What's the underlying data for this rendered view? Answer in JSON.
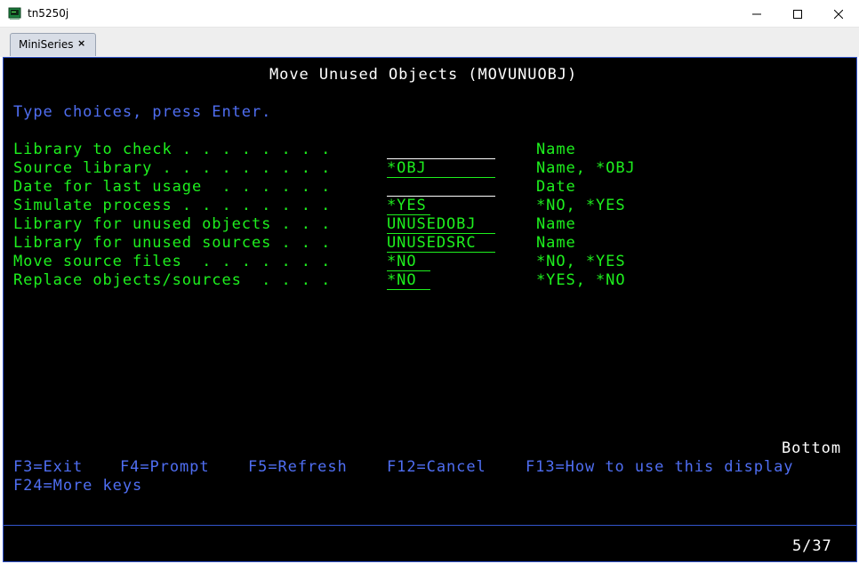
{
  "window": {
    "title": "tn5250j"
  },
  "tabs": [
    {
      "label": "MiniSeries",
      "close": "×"
    }
  ],
  "screen": {
    "title": "Move Unused Objects (MOVUNUOBJ)",
    "instruction": "Type choices, press Enter.",
    "rows": [
      {
        "label": "Library to check . . . . . . . .",
        "value": "",
        "hint": "Name"
      },
      {
        "label": "Source library . . . . . . . . .",
        "value": "*OBJ",
        "hint": "Name, *OBJ"
      },
      {
        "label": "Date for last usage  . . . . . .",
        "value": "",
        "hint": "Date"
      },
      {
        "label": "Simulate process . . . . . . . .",
        "value": "*YES",
        "hint": "*NO, *YES"
      },
      {
        "label": "Library for unused objects . . .",
        "value": "UNUSEDOBJ",
        "hint": "Name"
      },
      {
        "label": "Library for unused sources . . .",
        "value": "UNUSEDSRC",
        "hint": "Name"
      },
      {
        "label": "Move source files  . . . . . . .",
        "value": "*NO",
        "hint": "*NO, *YES"
      },
      {
        "label": "Replace objects/sources  . . . .",
        "value": "*NO",
        "hint": "*YES, *NO"
      }
    ],
    "bottom": "Bottom",
    "fkeys": {
      "f3": "F3=Exit",
      "f4": "F4=Prompt",
      "f5": "F5=Refresh",
      "f12": "F12=Cancel",
      "f13": "F13=How to use this display",
      "f24": "F24=More keys"
    },
    "cursor_position": "5/37"
  },
  "colors": {
    "background": "#000000",
    "field_text": "#1ef01e",
    "prompt_text": "#4f6ef2",
    "title_text": "#ffffff"
  }
}
